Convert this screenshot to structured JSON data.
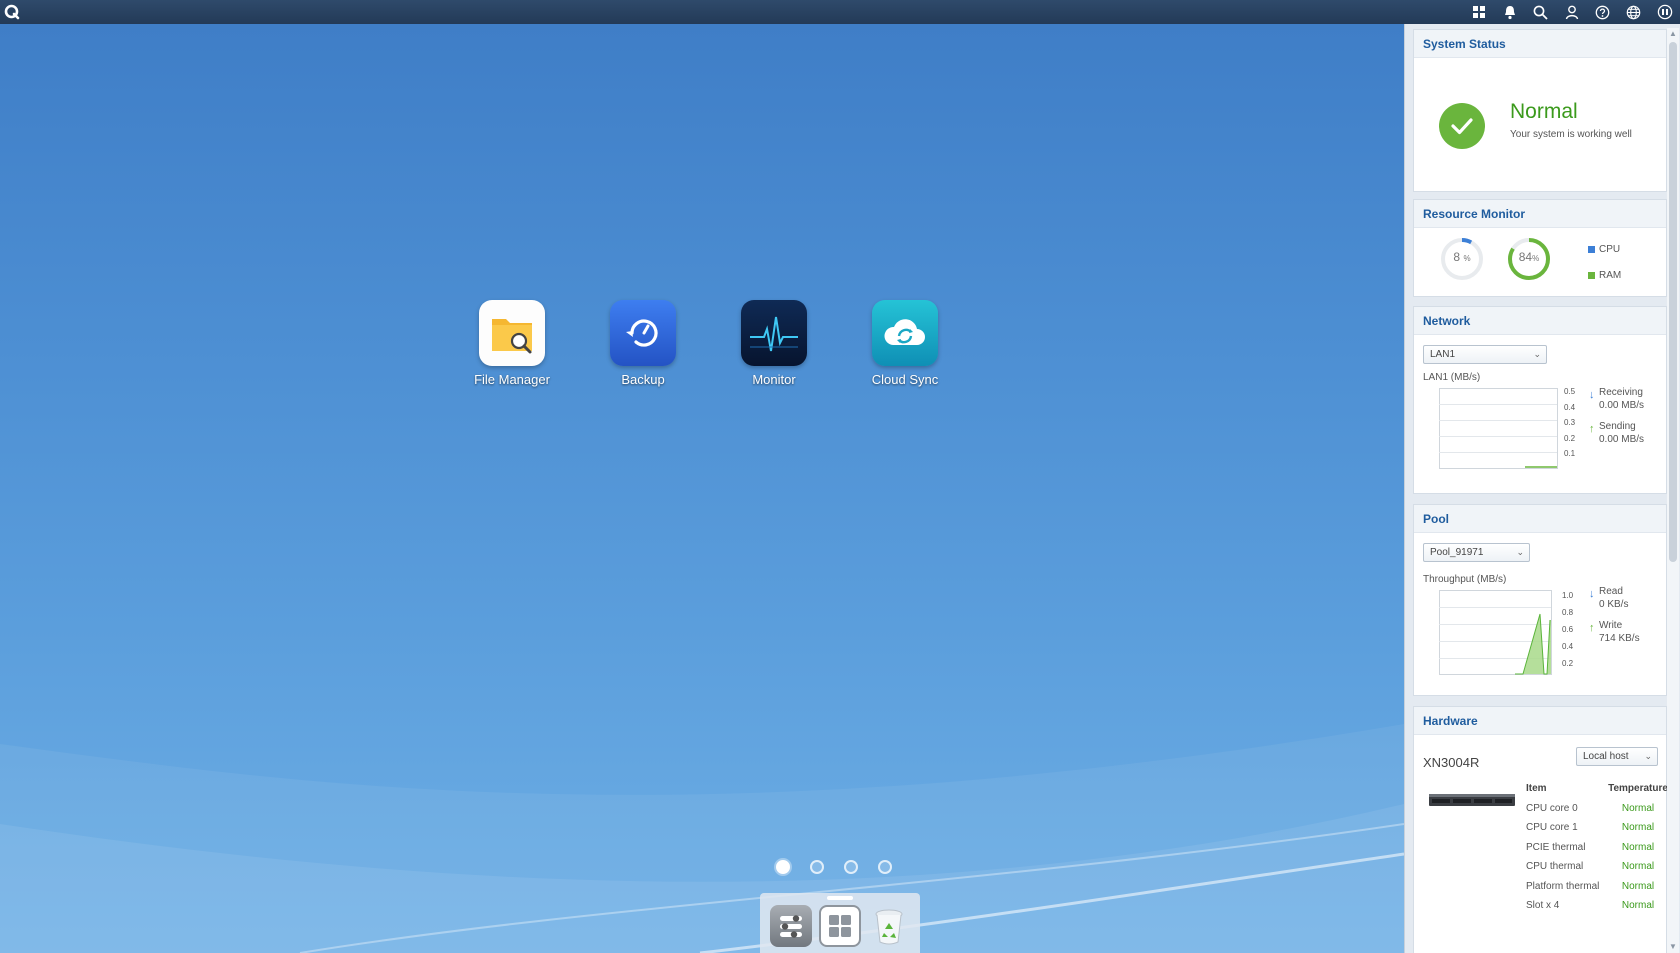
{
  "desktop": {
    "apps": [
      {
        "label": "File Manager",
        "icon": "file-manager-icon"
      },
      {
        "label": "Backup",
        "icon": "backup-icon"
      },
      {
        "label": "Monitor",
        "icon": "monitor-icon"
      },
      {
        "label": "Cloud Sync",
        "icon": "cloud-sync-icon"
      }
    ],
    "pages": 4,
    "active_page": 1
  },
  "dock": {
    "items": [
      "control-panel-icon",
      "app-center-icon",
      "recycle-bin-icon"
    ]
  },
  "topbar": {
    "icons": [
      "main-menu-icon",
      "apps-grid-icon",
      "notification-bell-icon",
      "search-icon",
      "user-icon",
      "help-icon",
      "language-globe-icon",
      "system-info-icon"
    ]
  },
  "panel": {
    "system_status": {
      "title": "System Status",
      "status": "Normal",
      "description": "Your system is working well",
      "color": "#3b9a1c"
    },
    "resource_monitor": {
      "title": "Resource Monitor",
      "cpu_value": "8",
      "cpu_unit": "%",
      "cpu_percent": 8,
      "ram_value": "84",
      "ram_unit": "%",
      "ram_percent": 84,
      "legend_cpu": "CPU",
      "legend_ram": "RAM",
      "cpu_color": "#3c7fd6",
      "ram_color": "#6ab53d"
    },
    "network": {
      "title": "Network",
      "selected_interface": "LAN1",
      "graph_label": "LAN1 (MB/s)",
      "ticks": [
        "0.5",
        "0.4",
        "0.3",
        "0.2",
        "0.1"
      ],
      "receiving_label": "Receiving",
      "receiving_value": "0.00 MB/s",
      "sending_label": "Sending",
      "sending_value": "0.00 MB/s"
    },
    "pool": {
      "title": "Pool",
      "selected_pool": "Pool_91971",
      "graph_label": "Throughput (MB/s)",
      "ticks": [
        "1.0",
        "0.8",
        "0.6",
        "0.4",
        "0.2"
      ],
      "read_label": "Read",
      "read_value": "0 KB/s",
      "write_label": "Write",
      "write_value": "714 KB/s"
    },
    "hardware": {
      "title": "Hardware",
      "model": "XN3004R",
      "host_select": "Local host",
      "col_item": "Item",
      "col_temp": "Temperature",
      "rows": [
        {
          "item": "CPU core 0",
          "temp": "Normal"
        },
        {
          "item": "CPU core 1",
          "temp": "Normal"
        },
        {
          "item": "PCIE thermal",
          "temp": "Normal"
        },
        {
          "item": "CPU thermal",
          "temp": "Normal"
        },
        {
          "item": "Platform thermal",
          "temp": "Normal"
        },
        {
          "item": "Slot x 4",
          "temp": "Normal"
        }
      ]
    }
  }
}
